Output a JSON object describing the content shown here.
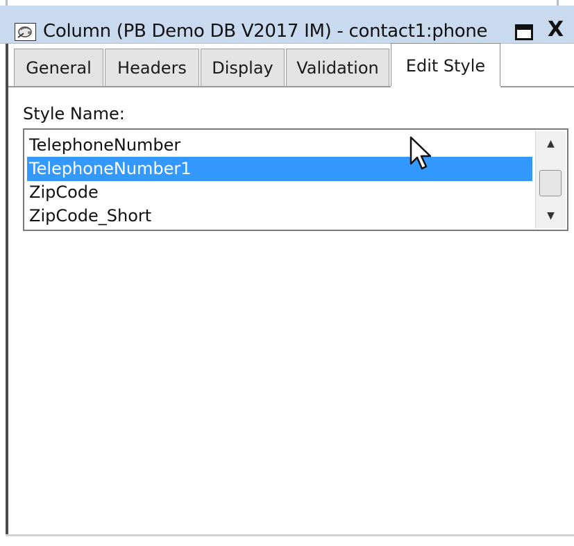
{
  "window": {
    "title": "Column (PB Demo DB V2017 IM) - contact1:phone",
    "icon": "column-properties-icon",
    "restore_icon": "restore-icon",
    "close_label": "X"
  },
  "tabs": [
    {
      "label": "General",
      "active": false
    },
    {
      "label": "Headers",
      "active": false
    },
    {
      "label": "Display",
      "active": false
    },
    {
      "label": "Validation",
      "active": false
    },
    {
      "label": "Edit Style",
      "active": true
    }
  ],
  "style_name": {
    "label": "Style Name:",
    "items": [
      {
        "label": "TelephoneNumber",
        "selected": false
      },
      {
        "label": "TelephoneNumber1",
        "selected": true
      },
      {
        "label": "ZipCode",
        "selected": false
      },
      {
        "label": "ZipCode_Short",
        "selected": false
      }
    ],
    "selected_color": "#3399ff"
  },
  "scrollbar": {
    "up_icon": "scroll-up-arrow-icon",
    "down_icon": "scroll-down-arrow-icon",
    "up_glyph": "▲",
    "down_glyph": "▼"
  },
  "colors": {
    "titlebar": "#c9d9ee",
    "tab_inactive": "#e3e3e3",
    "selection": "#3399ff"
  }
}
